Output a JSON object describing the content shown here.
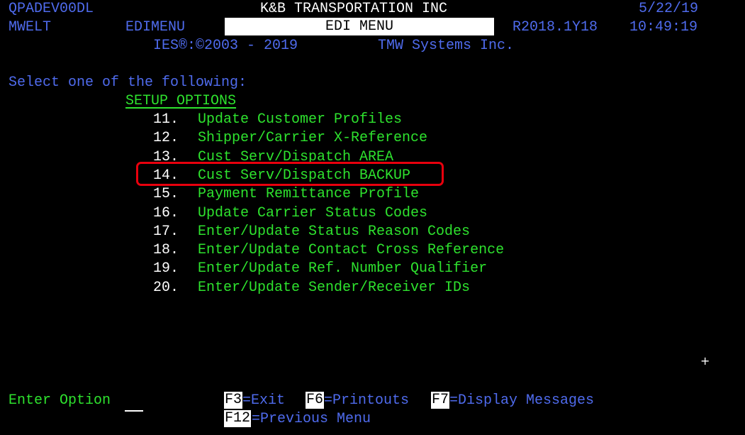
{
  "header": {
    "system_id": "QPADEV00DL",
    "company": "K&B TRANSPORTATION INC",
    "date": "5/22/19",
    "user": "MWELT",
    "program": "EDIMENU",
    "menu_title": "EDI MENU",
    "release": "R2018.1Y18",
    "time": "10:49:19",
    "copyright": "IES®:©2003 - 2019",
    "vendor": "TMW Systems Inc."
  },
  "prompt": "Select one of the following:",
  "section_title": "SETUP OPTIONS",
  "options": [
    {
      "number": "11.",
      "label": "Update Customer Profiles"
    },
    {
      "number": "12.",
      "label": "Shipper/Carrier X-Reference"
    },
    {
      "number": "13.",
      "label": "Cust Serv/Dispatch AREA"
    },
    {
      "number": "14.",
      "label": "Cust Serv/Dispatch BACKUP"
    },
    {
      "number": "15.",
      "label": "Payment Remittance Profile"
    },
    {
      "number": "16.",
      "label": "Update Carrier Status Codes"
    },
    {
      "number": "17.",
      "label": "Enter/Update Status Reason Codes"
    },
    {
      "number": "18.",
      "label": "Enter/Update Contact Cross Reference"
    },
    {
      "number": "19.",
      "label": "Enter/Update Ref. Number Qualifier"
    },
    {
      "number": "20.",
      "label": "Enter/Update Sender/Receiver IDs"
    }
  ],
  "highlighted_option": "14.",
  "cursor_glyph": "+",
  "footer": {
    "enter_option_label": "Enter Option",
    "enter_option_value": "",
    "keys": [
      {
        "key": "F3",
        "action": "=Exit"
      },
      {
        "key": "F6",
        "action": "=Printouts"
      },
      {
        "key": "F7",
        "action": "=Display Messages"
      },
      {
        "key": "F12",
        "action": "=Previous Menu"
      }
    ]
  },
  "colors": {
    "background": "#000000",
    "field_text": "#4f6bed",
    "option_text": "#2ee22e",
    "highlight_border": "#e8000d"
  }
}
